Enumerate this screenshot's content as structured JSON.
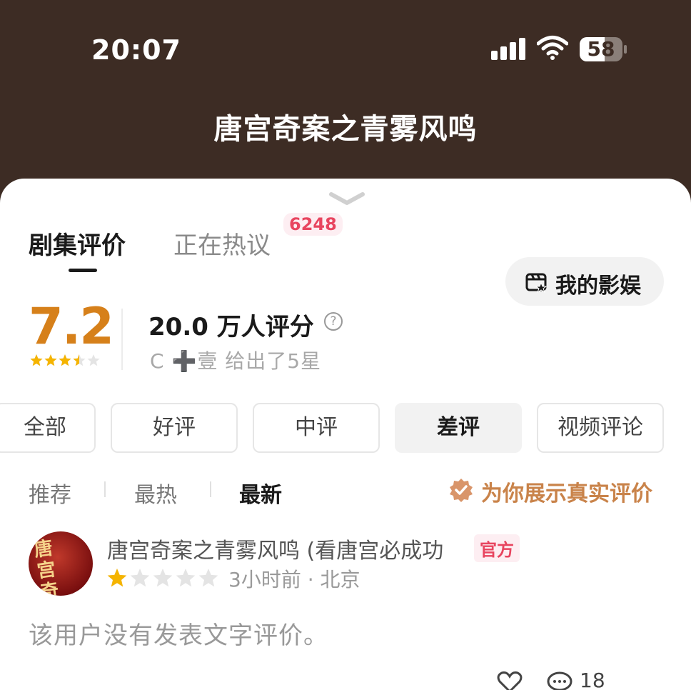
{
  "status_bar": {
    "time": "20:07",
    "battery_level": "58",
    "battery_fraction": 0.58
  },
  "nav": {
    "title": "唐宫奇案之青雾风鸣"
  },
  "tabs": {
    "active": "剧集评价",
    "inactive": "正在热议",
    "hot_count": "6248"
  },
  "my_entertainment": {
    "label": "我的影娱"
  },
  "rating": {
    "score": "7.2",
    "stars": 3.5,
    "count": "20.0 万人评分",
    "help": "?",
    "friend_note": "C ➕壹 给出了5星"
  },
  "filters": [
    "全部",
    "好评",
    "中评",
    "差评",
    "视频评论"
  ],
  "selected_filter": "差评",
  "sort": {
    "items": [
      "推荐",
      "最热",
      "最新"
    ],
    "active": "最新"
  },
  "real_badge": {
    "label": "为你展示真实评价"
  },
  "review": {
    "author": "唐宫奇案之青雾风鸣 (看唐宫必成功",
    "official_tag": "官方",
    "avatar_text": "唐宫奇案",
    "stars": 1,
    "meta": "3小时前 · 北京",
    "text": "该用户没有发表文字评价。",
    "comment_count": "18"
  },
  "colors": {
    "header_bg": "#3d2c24",
    "score": "#d6801a",
    "accent_pink": "#e8455f",
    "real_badge": "#c9834a",
    "star": "#f5b400"
  },
  "icons": [
    "wifi-icon",
    "signal-icon",
    "battery-icon",
    "chevron-down-icon",
    "film-star-icon",
    "help-icon",
    "verified-badge-icon",
    "heart-icon",
    "comment-icon",
    "star-icon"
  ]
}
